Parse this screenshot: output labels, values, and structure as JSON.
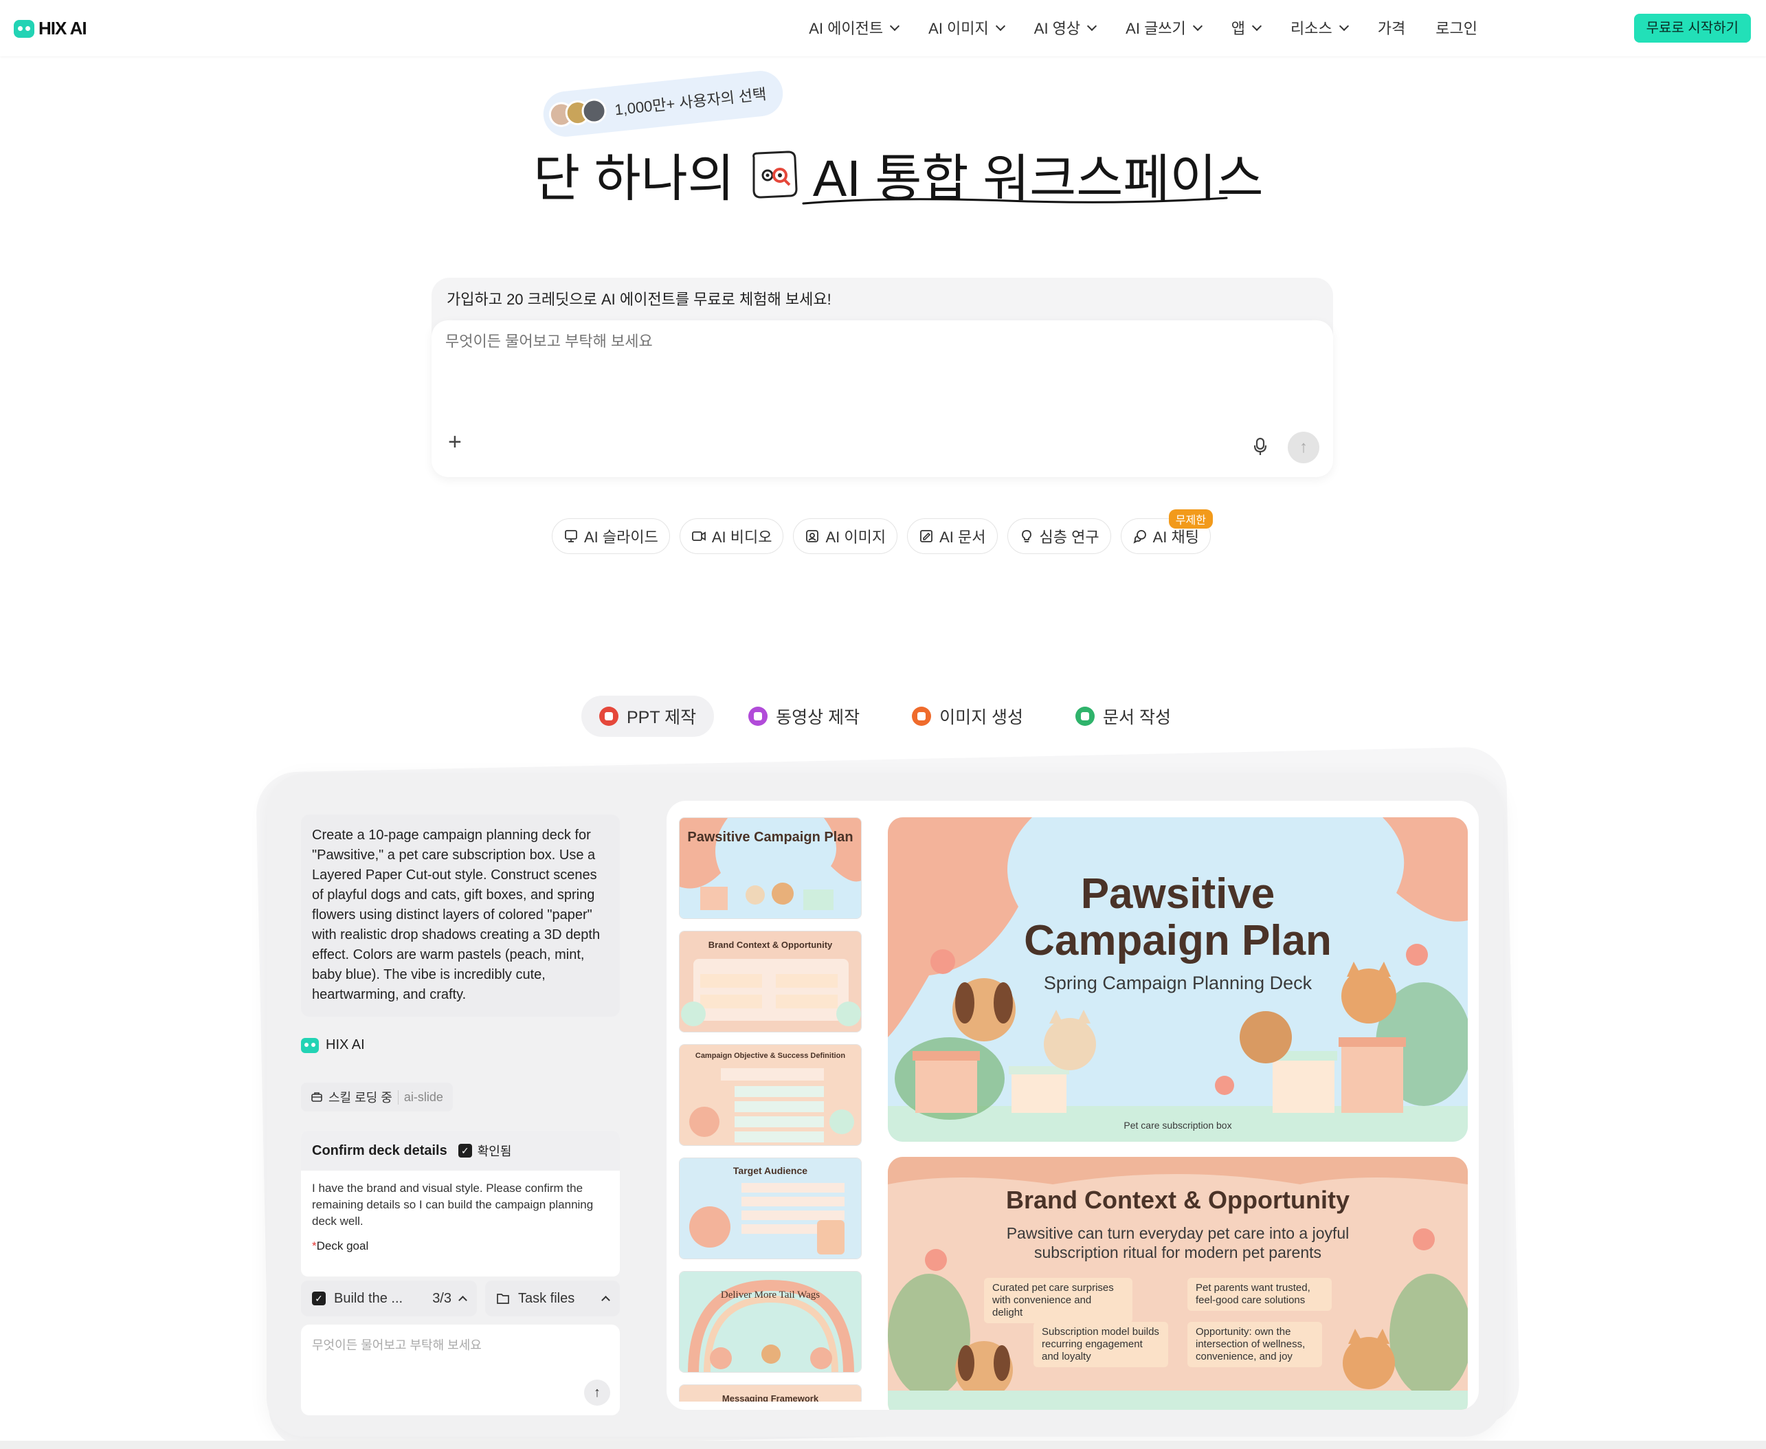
{
  "header": {
    "logo": "HIX AI",
    "nav": [
      {
        "label": "AI 에이전트",
        "dropdown": true
      },
      {
        "label": "AI 이미지",
        "dropdown": true
      },
      {
        "label": "AI 영상",
        "dropdown": true
      },
      {
        "label": "AI 글쓰기",
        "dropdown": true
      },
      {
        "label": "앱",
        "dropdown": true
      },
      {
        "label": "리소스",
        "dropdown": true
      },
      {
        "label": "가격",
        "dropdown": false
      },
      {
        "label": "로그인",
        "dropdown": false
      }
    ],
    "cta": "무료로 시작하기"
  },
  "hero": {
    "badge": "1,000만+ 사용자의 선택",
    "title_plain": "단 하나의",
    "title_accent": "AI 통합 워크스페이스"
  },
  "prompt": {
    "banner": "가입하고 20 크레딧으로 AI 에이전트를 무료로 체험해 보세요!",
    "placeholder": "무엇이든 물어보고 부탁해 보세요"
  },
  "chips": [
    {
      "label": "AI 슬라이드",
      "icon": "slide-icon"
    },
    {
      "label": "AI 비디오",
      "icon": "video-icon"
    },
    {
      "label": "AI 이미지",
      "icon": "image-icon"
    },
    {
      "label": "AI 문서",
      "icon": "document-icon"
    },
    {
      "label": "심층 연구",
      "icon": "bulb-icon"
    },
    {
      "label": "AI 채팅",
      "icon": "chat-icon",
      "tag": "무제한"
    }
  ],
  "tabs": [
    {
      "label": "PPT 제작",
      "active": true,
      "color": "#e5483b"
    },
    {
      "label": "동영상 제작",
      "active": false,
      "color": "#b14bd9"
    },
    {
      "label": "이미지 생성",
      "active": false,
      "color": "#ef6b2c"
    },
    {
      "label": "문서 작성",
      "active": false,
      "color": "#2fb36b"
    }
  ],
  "demo": {
    "request": "Create a 10-page campaign planning deck for \"Pawsitive,\" a pet care subscription box. Use a Layered Paper Cut-out  style. Construct scenes of playful dogs and cats, gift boxes, and spring flowers using distinct layers of colored \"paper\" with realistic drop shadows creating a 3D depth effect. Colors are warm pastels (peach, mint, baby blue). The vibe is incredibly cute, heartwarming, and crafty.",
    "agent_name": "HIX AI",
    "skill_label": "스킬 로딩 중",
    "skill_name": "ai-slide",
    "confirm_title": "Confirm deck details",
    "confirm_status": "확인됨",
    "confirm_body": "I have the brand and visual style. Please confirm the remaining details so I can build the campaign planning deck well.",
    "deck_goal_label": "Deck goal",
    "build_label": "Build the ...",
    "build_progress": "3/3",
    "task_files_label": "Task files",
    "input_placeholder": "무엇이든 물어보고 부탁해 보세요",
    "thumbnails": [
      "Pawsitive Campaign Plan",
      "Brand Context & Opportunity",
      "Campaign Objective & Success Definition",
      "Target Audience",
      "Deliver More Tail Wags",
      "Messaging Framework"
    ],
    "slide1": {
      "title_line1": "Pawsitive",
      "title_line2": "Campaign Plan",
      "subtitle": "Spring Campaign Planning Deck",
      "footer": "Pet care subscription box"
    },
    "slide2": {
      "title": "Brand Context & Opportunity",
      "subtitle_line1": "Pawsitive can turn everyday pet care into a joyful",
      "subtitle_line2": "subscription ritual for modern pet parents",
      "bullets": [
        "Curated pet care surprises with convenience and delight",
        "Pet parents want trusted, feel-good care solutions",
        "Subscription model builds recurring engagement and loyalty",
        "Opportunity: own the intersection of wellness, convenience, and joy"
      ]
    }
  },
  "colors": {
    "accent": "#22e0b8",
    "peach": "#f3b39a",
    "mint": "#cfeedd",
    "baby_blue": "#d3ecf8",
    "tag_orange": "#f29a1b"
  }
}
